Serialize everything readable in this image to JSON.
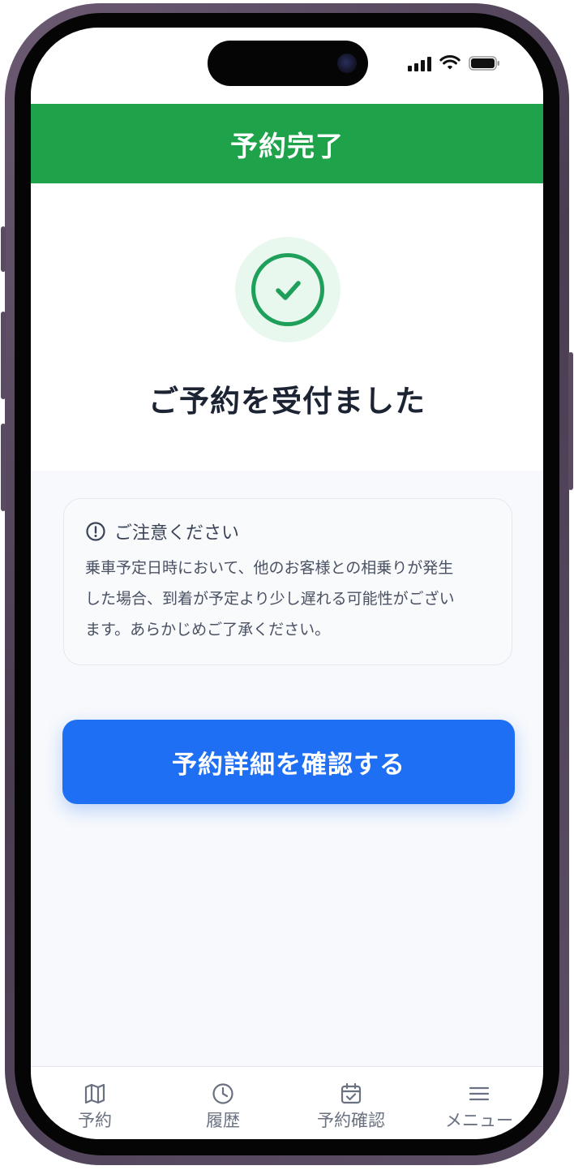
{
  "header": {
    "title": "予約完了"
  },
  "success": {
    "message": "ご予約を受付ました"
  },
  "notice": {
    "title": "ご注意ください",
    "lines": [
      "乗車予定日時において、他のお客様との相乗りが発生",
      "した場合、到着が予定より少し遅れる可能性がござい",
      "ます。あらかじめご了承ください。"
    ]
  },
  "primary_button": {
    "label": "予約詳細を確認する"
  },
  "nav": {
    "items": [
      {
        "label": "予約",
        "icon": "map-icon"
      },
      {
        "label": "履歴",
        "icon": "clock-icon"
      },
      {
        "label": "予約確認",
        "icon": "calendar-check-icon"
      },
      {
        "label": "メニュー",
        "icon": "menu-icon"
      }
    ]
  },
  "colors": {
    "header": "#1fa34a",
    "success": "#1fa05a",
    "primary": "#1f6ff5"
  }
}
